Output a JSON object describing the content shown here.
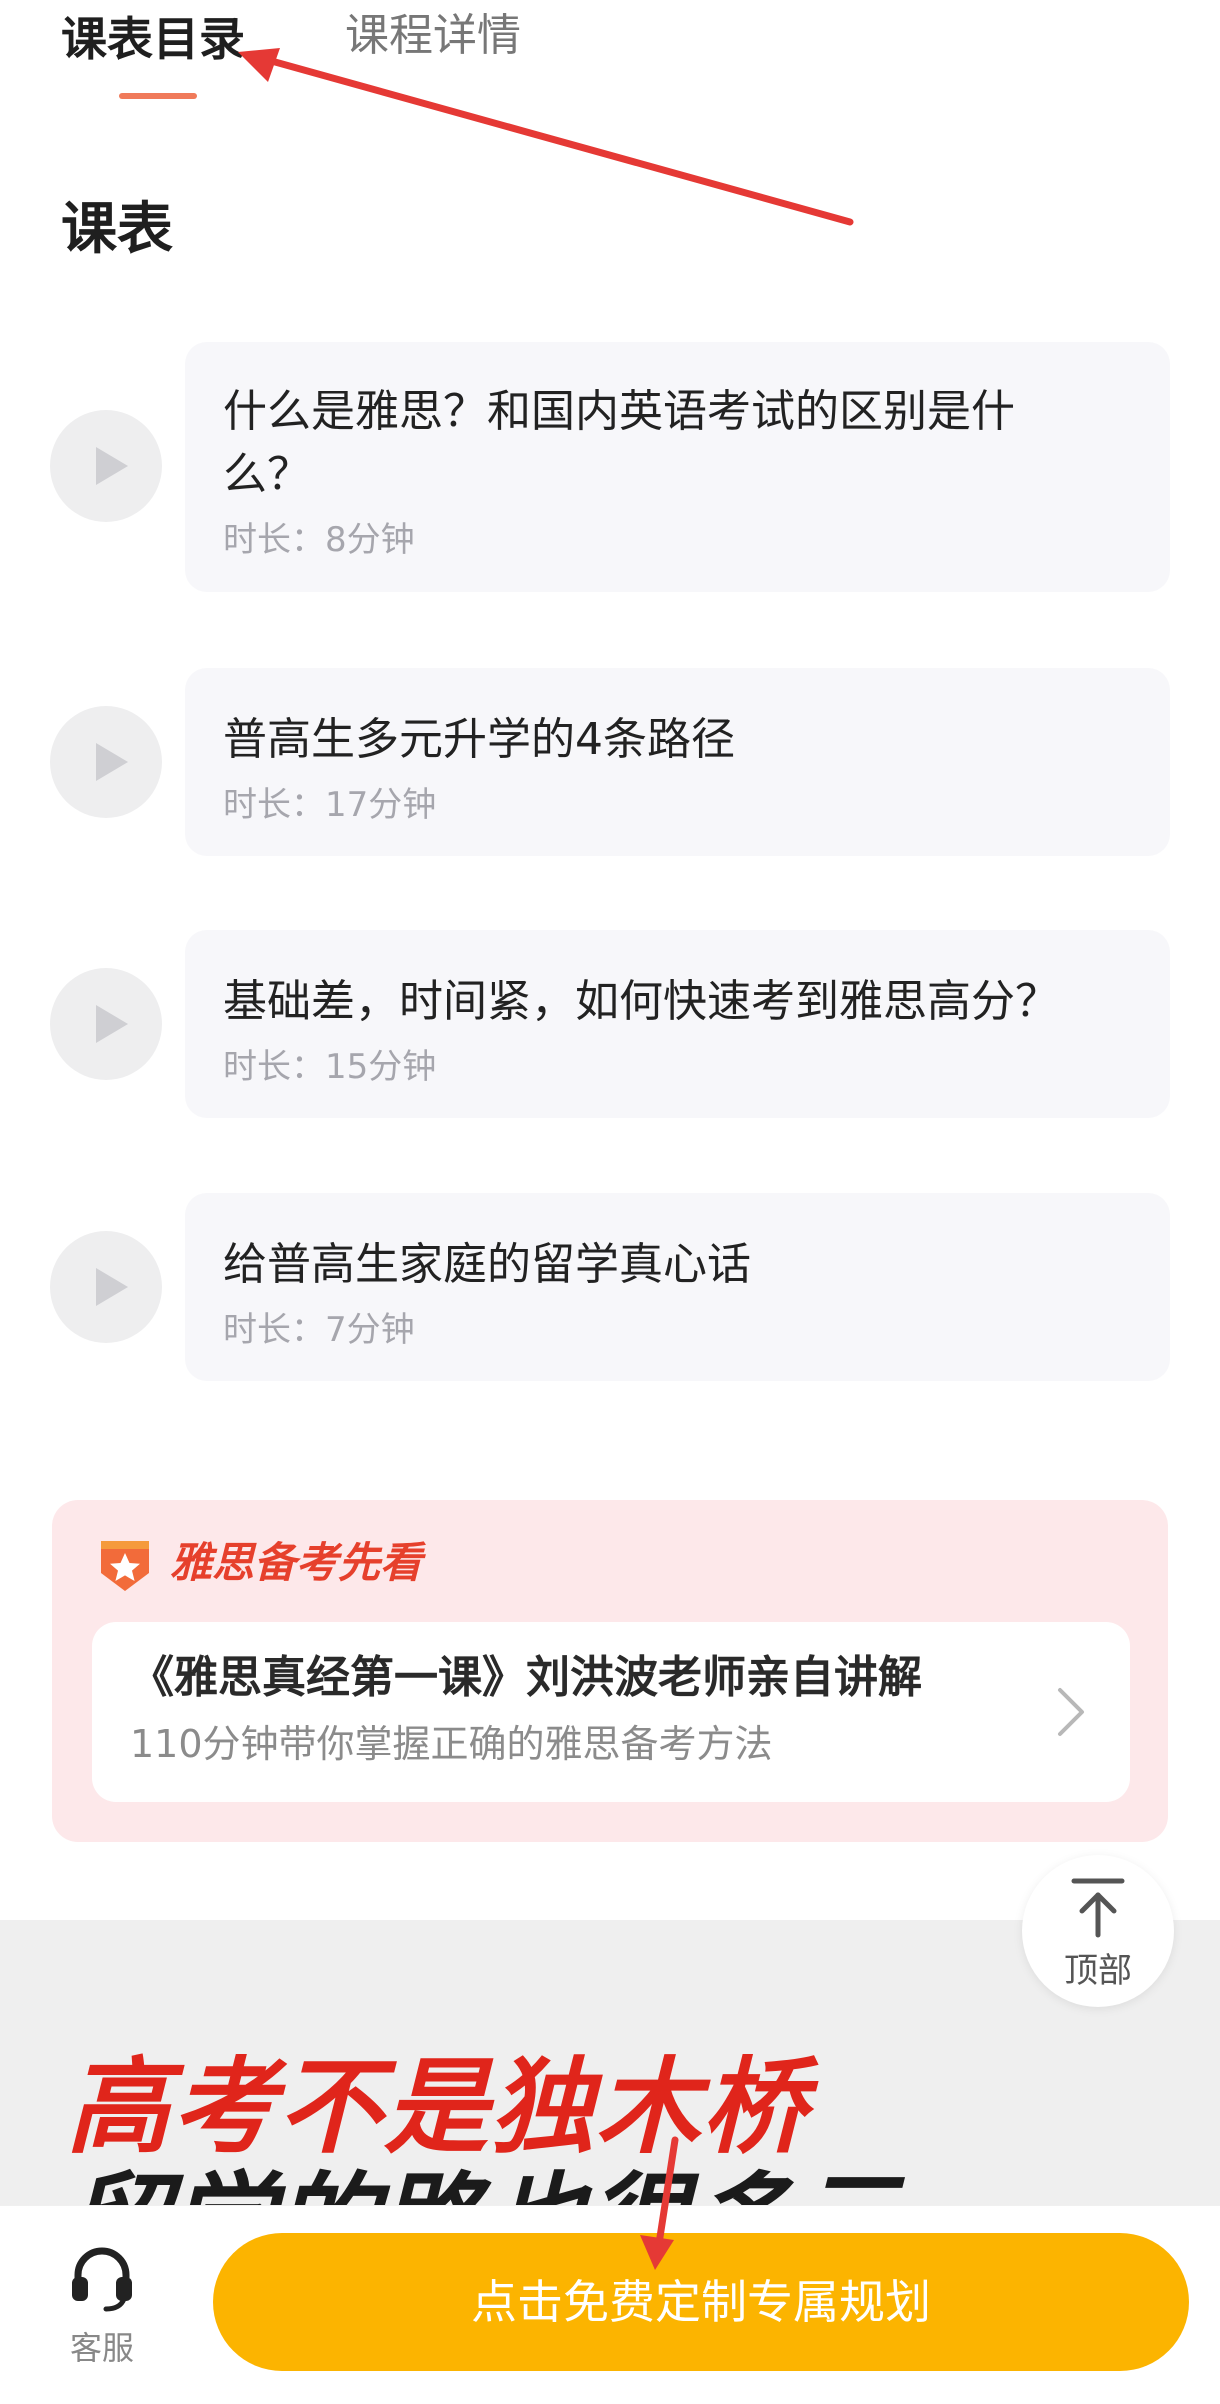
{
  "tabs": {
    "active": "课表目录",
    "other": "课程详情"
  },
  "section_title": "课表",
  "lessons": [
    {
      "title": "什么是雅思？和国内英语考试的区别是什么？",
      "duration": "时长：8分钟"
    },
    {
      "title": "普高生多元升学的4条路径",
      "duration": "时长：17分钟"
    },
    {
      "title": "基础差，时间紧，如何快速考到雅思高分？",
      "duration": "时长：15分钟"
    },
    {
      "title": "给普高生家庭的留学真心话",
      "duration": "时长：7分钟"
    }
  ],
  "promo": {
    "label": "雅思备考先看",
    "title": "《雅思真经第一课》刘洪波老师亲自讲解",
    "subtitle": "110分钟带你掌握正确的雅思备考方法"
  },
  "back_to_top": "顶部",
  "banner": {
    "line1": "高考不是独木桥",
    "line2": "留学的路也很多元"
  },
  "bottom_bar": {
    "service_label": "客服",
    "cta_label": "点击免费定制专属规划"
  },
  "colors": {
    "accent_orange": "#fcb400",
    "tab_underline": "#f07a5a",
    "promo_red": "#e6402c",
    "annotation_red": "#e53935"
  },
  "icons": [
    "play-icon",
    "star-badge-icon",
    "chevron-right-icon",
    "arrow-up-icon",
    "headset-icon"
  ]
}
